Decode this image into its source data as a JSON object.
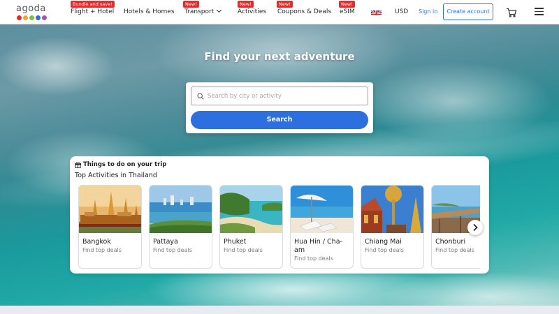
{
  "header": {
    "logo": "agoda",
    "logo_colors": [
      "#e12d2d",
      "#f5a623",
      "#7bc043",
      "#2b6ee8",
      "#9b59b6"
    ],
    "nav": [
      {
        "label": "Flight + Hotel",
        "badge": "Bundle and save!"
      },
      {
        "label": "Hotels & Homes",
        "badge": ""
      },
      {
        "label": "Transport",
        "badge": "New!",
        "dropdown": true
      },
      {
        "label": "Activities",
        "badge": "New!"
      },
      {
        "label": "Coupons & Deals",
        "badge": "New!"
      },
      {
        "label": "eSIM",
        "badge": "New!"
      }
    ],
    "currency": "USD",
    "sign_in": "Sign in",
    "create_account": "Create account",
    "language_icon": "uk-flag-icon",
    "cart_icon": "cart-icon",
    "menu_icon": "hamburger-menu-icon"
  },
  "hero": {
    "title": "Find your next adventure"
  },
  "search": {
    "placeholder": "Search by city or activity",
    "value": "",
    "button_label": "Search",
    "accent": "#2e6fe0"
  },
  "activities": {
    "heading": "Things to do on your trip",
    "subheading": "Top Activities in Thailand",
    "cards": [
      {
        "city": "Bangkok",
        "deals": "Find top deals"
      },
      {
        "city": "Pattaya",
        "deals": "Find top deals"
      },
      {
        "city": "Phuket",
        "deals": "Find top deals"
      },
      {
        "city": "Hua Hin / Cha-am",
        "deals": "Find top deals"
      },
      {
        "city": "Chiang Mai",
        "deals": "Find top deals"
      },
      {
        "city": "Chonburi",
        "deals": "Find top deals"
      }
    ]
  }
}
